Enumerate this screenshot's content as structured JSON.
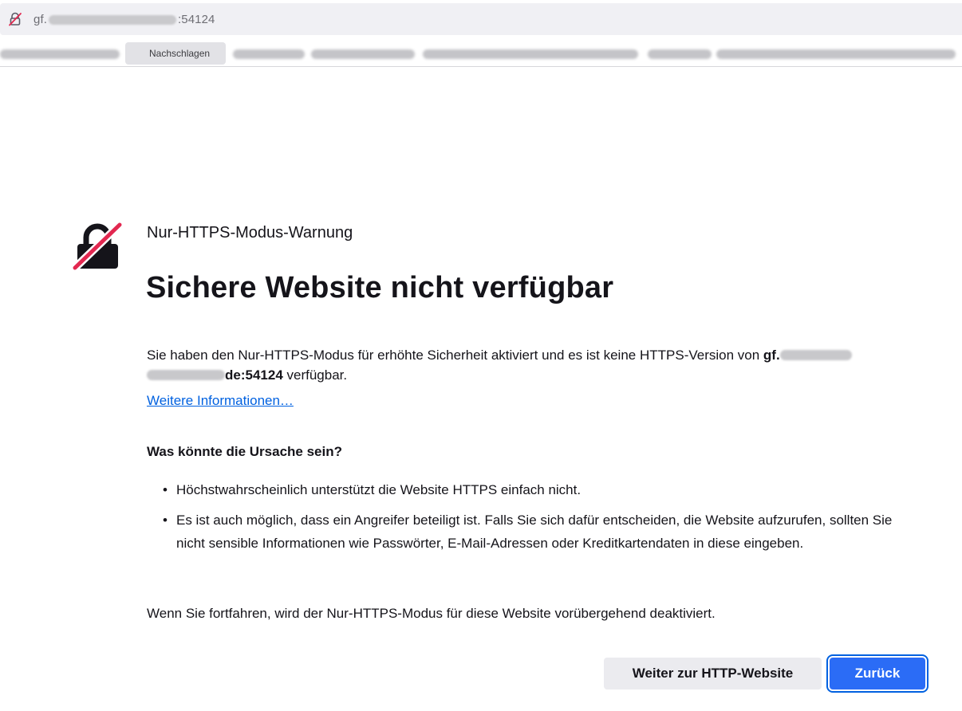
{
  "browser": {
    "url_prefix": "gf.",
    "url_suffix": ":54124",
    "bookmark_label": "Nachschlagen"
  },
  "page": {
    "eyebrow": "Nur-HTTPS-Modus-Warnung",
    "title": "Sichere Website nicht verfügbar",
    "intro_text": "Sie haben den Nur-HTTPS-Modus für erhöhte Sicherheit aktiviert und es ist keine HTTPS-Version von",
    "host_visible_part1": "gf.",
    "host_visible_part2": "de:54124",
    "intro_end": "verfügbar.",
    "more_info_link": "Weitere Informationen…",
    "cause_heading": "Was könnte die Ursache sein?",
    "causes": [
      "Höchstwahrscheinlich unterstützt die Website HTTPS einfach nicht.",
      "Es ist auch möglich, dass ein Angreifer beteiligt ist. Falls Sie sich dafür entscheiden, die Website aufzurufen, sollten Sie nicht sensible Informationen wie Passwörter, E-Mail-Adressen oder Kreditkartendaten in diese eingeben."
    ],
    "note": "Wenn Sie fortfahren, wird der Nur-HTTPS-Modus für diese Website vorübergehend deaktiviert.",
    "continue_button": "Weiter zur HTTP-Website",
    "back_button": "Zurück"
  },
  "colors": {
    "accent": "#0061e0",
    "warning_slash": "#e22850",
    "text": "#15141a"
  },
  "icons": {
    "address_bar": "insecure-lock-icon",
    "page": "insecure-lock-icon"
  }
}
